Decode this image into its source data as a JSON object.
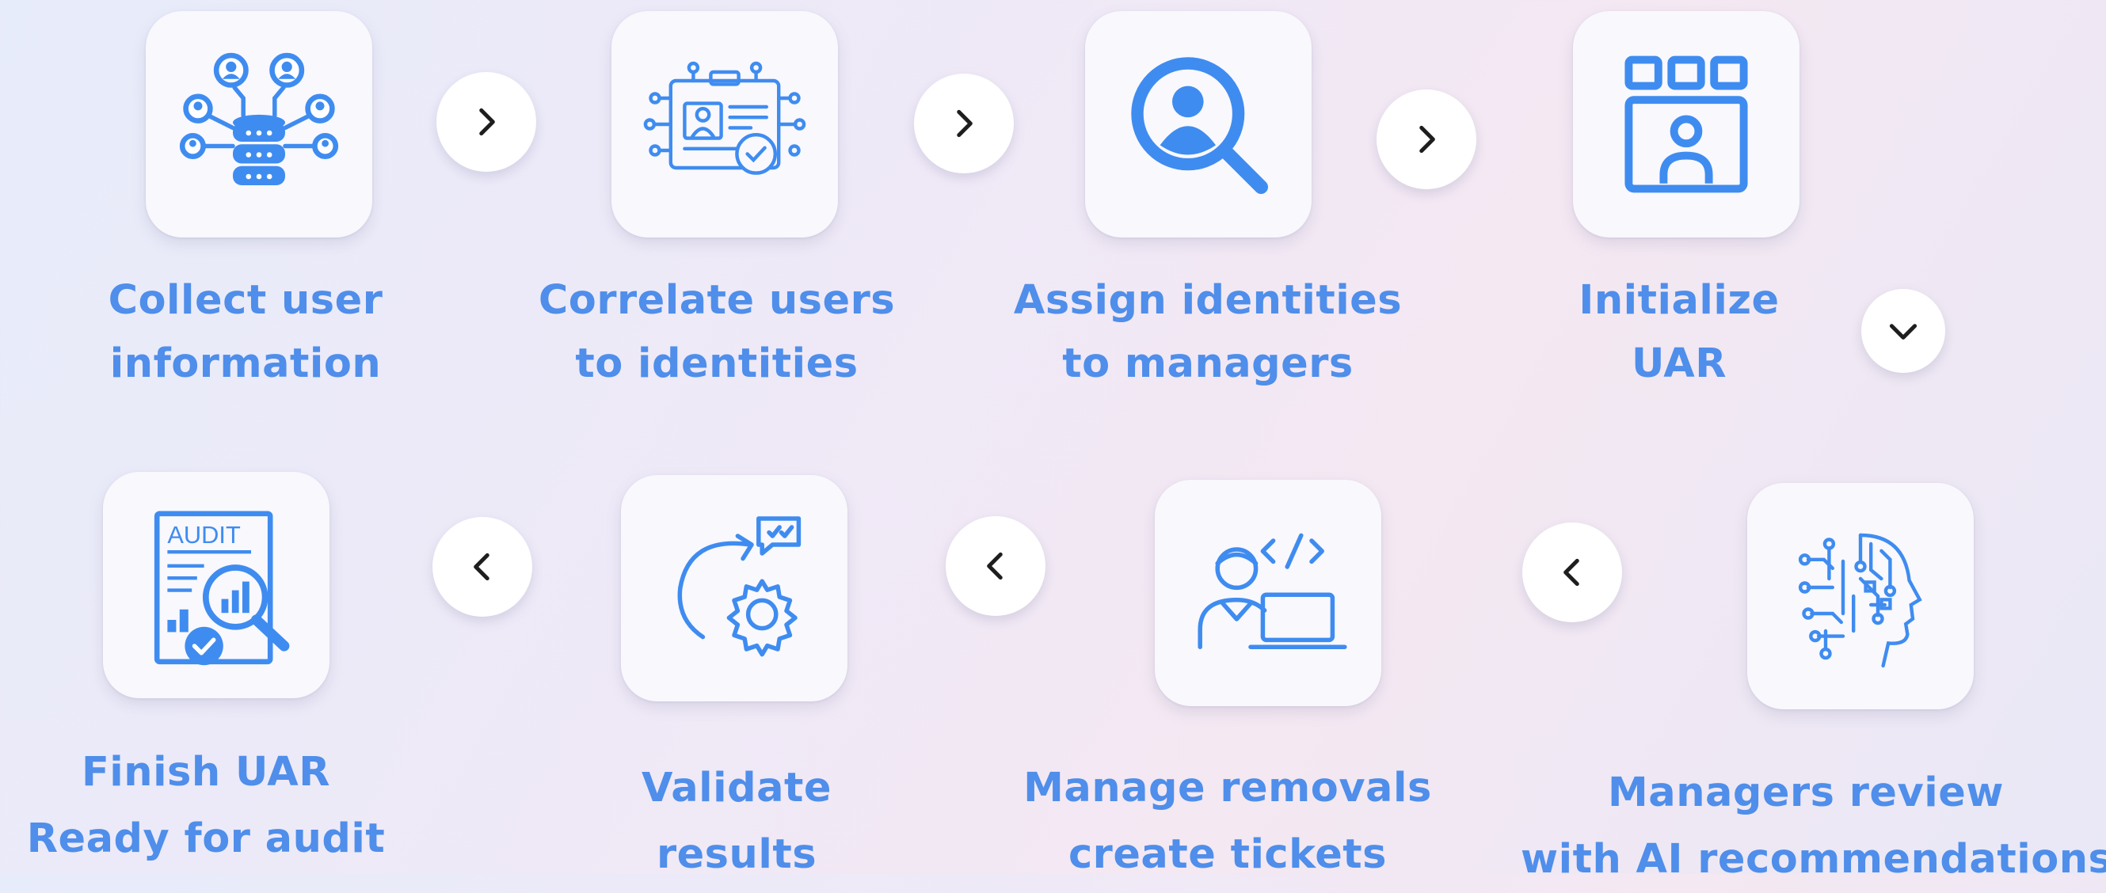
{
  "colors": {
    "accent": "#3f8cf0",
    "label": "#4f8eea",
    "card": "#f8f8fd"
  },
  "steps": [
    {
      "id": 1,
      "icon": "database-users-icon",
      "line1": "Collect user",
      "line2": "information"
    },
    {
      "id": 2,
      "icon": "id-card-check-icon",
      "line1": "Correlate users",
      "line2": "to identities"
    },
    {
      "id": 3,
      "icon": "user-search-icon",
      "line1": "Assign identities",
      "line2": "to managers"
    },
    {
      "id": 4,
      "icon": "dashboard-user-icon",
      "line1": "Initialize",
      "line2": "UAR"
    },
    {
      "id": 5,
      "icon": "ai-brain-icon",
      "line1": "Managers review",
      "line2": "with AI recommendations"
    },
    {
      "id": 6,
      "icon": "developer-laptop-icon",
      "line1": "Manage removals",
      "line2": "create tickets"
    },
    {
      "id": 7,
      "icon": "gear-cycle-check-icon",
      "line1": "Validate",
      "line2": "results"
    },
    {
      "id": 8,
      "icon": "audit-report-icon",
      "line1": "Finish UAR",
      "line2": "Ready for audit"
    }
  ],
  "arrows": [
    {
      "icon": "chevron-right-icon"
    },
    {
      "icon": "chevron-right-icon"
    },
    {
      "icon": "chevron-right-icon"
    },
    {
      "icon": "chevron-down-icon"
    },
    {
      "icon": "chevron-left-icon"
    },
    {
      "icon": "chevron-left-icon"
    },
    {
      "icon": "chevron-left-icon"
    }
  ]
}
